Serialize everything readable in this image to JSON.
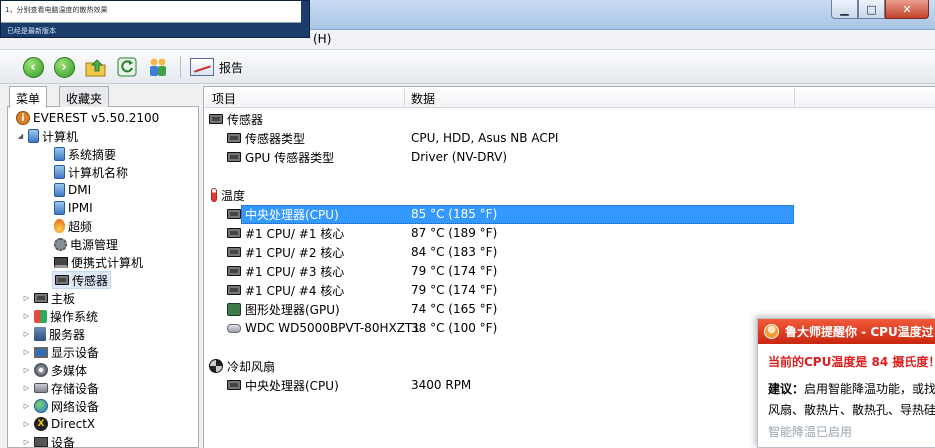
{
  "menu": {
    "help": "(H)"
  },
  "overlay": {
    "message": "1，分别查看电脑温度的散热效果",
    "status": "已经是最新版本"
  },
  "toolbar": {
    "back_icon": "back-arrow-icon",
    "forward_icon": "forward-arrow-icon",
    "up_icon": "folder-up-icon",
    "refresh_icon": "refresh-icon",
    "users_icon": "users-icon",
    "report_label": "报告"
  },
  "left_tabs": {
    "menu": "菜单",
    "favorites": "收藏夹"
  },
  "tree": {
    "root": "EVEREST v5.50.2100",
    "computer": "计算机",
    "computer_children": [
      "系统摘要",
      "计算机名称",
      "DMI",
      "IPMI",
      "超频",
      "电源管理",
      "便携式计算机",
      "传感器"
    ],
    "categories": [
      "主板",
      "操作系统",
      "服务器",
      "显示设备",
      "多媒体",
      "存储设备",
      "网络设备",
      "DirectX",
      "设备"
    ]
  },
  "list": {
    "col_item": "项目",
    "col_data": "数据",
    "group_sensor": "传感器",
    "sensor_type_label": "传感器类型",
    "sensor_type_value": "CPU, HDD, Asus NB ACPI",
    "gpu_sensor_label": "GPU 传感器类型",
    "gpu_sensor_value": "Driver  (NV-DRV)",
    "group_temp": "温度",
    "temps": [
      {
        "label": "中央处理器(CPU)",
        "value": "85 °C  (185 °F)"
      },
      {
        "label": "#1 CPU/ #1 核心",
        "value": "87 °C  (189 °F)"
      },
      {
        "label": "#1 CPU/ #2 核心",
        "value": "84 °C  (183 °F)"
      },
      {
        "label": "#1 CPU/ #3 核心",
        "value": "79 °C  (174 °F)"
      },
      {
        "label": "#1 CPU/ #4 核心",
        "value": "79 °C  (174 °F)"
      },
      {
        "label": "图形处理器(GPU)",
        "value": "74 °C  (165 °F)"
      },
      {
        "label": "WDC WD5000BPVT-80HXZT1",
        "value": "38 °C  (100 °F)"
      }
    ],
    "group_fan": "冷却风扇",
    "fan_label": "中央处理器(CPU)",
    "fan_value": "3400 RPM"
  },
  "notify": {
    "title": "鲁大师提醒你 - CPU温度过",
    "line1": "当前的CPU温度是 84 摄氏度！",
    "line2_bold": "建议：",
    "line2_rest": "启用智能降温功能，或找",
    "line3": "风扇、散热片、散热孔、导热硅",
    "link": "智能降温已启用"
  },
  "colors": {
    "selection": "#3399ff",
    "notify_red": "#e01e1e",
    "notify_head": "#d9361a"
  }
}
